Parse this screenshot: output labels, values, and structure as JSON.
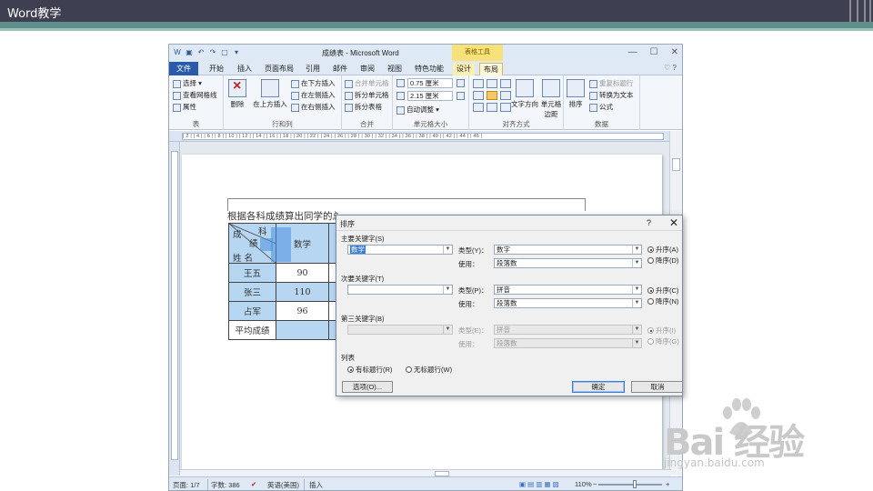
{
  "slide": {
    "title": "Word教学"
  },
  "window": {
    "title": "成绩表 - Microsoft Word",
    "context_tab_title": "表格工具",
    "controls": {
      "minimize": "—",
      "maximize": "☐",
      "close": "✕"
    },
    "qat": [
      "W",
      "▣",
      "↶",
      "↷",
      "▢",
      "▾"
    ]
  },
  "tabs": {
    "file": "文件",
    "items": [
      "开始",
      "插入",
      "页面布局",
      "引用",
      "邮件",
      "审阅",
      "视图",
      "特色功能",
      "设计",
      "布局"
    ],
    "right": "♡ ?"
  },
  "ribbon": {
    "table_group": {
      "label": "表",
      "items": [
        "选择 ▾",
        "查看网格线",
        "属性"
      ]
    },
    "rows_cols_group": {
      "label": "行和列",
      "delete": "删除",
      "insert_above": "在上方插入",
      "items": [
        "在下方插入",
        "在左侧插入",
        "在右侧插入"
      ]
    },
    "merge_group": {
      "label": "合并",
      "items": [
        "合并单元格",
        "拆分单元格",
        "拆分表格"
      ]
    },
    "cell_size_group": {
      "label": "单元格大小",
      "height": "0.75 厘米",
      "width": "2.15 厘米",
      "autofit": "自动调整 ▾"
    },
    "align_group": {
      "label": "对齐方式",
      "text_direction": "文字方向",
      "cell_margins": "单元格边距"
    },
    "data_group": {
      "label": "数据",
      "sort": "排序",
      "items": [
        "重复标题行",
        "转换为文本",
        "公式"
      ]
    }
  },
  "ruler": {
    "text": "| 2 | | 4 | | 6 | | 8 | | 10 | | 12 | | 14 | | 16 | | 18 | | 20 | | 22 | | 24 | | 26 | | 28 | | 30 | | 32 | | 34 | | 36 | | 38 | | 40 | | 42 | | 44 | | 46 |"
  },
  "document": {
    "sentence": "根据各科成绩算出同学的总",
    "header_cell": {
      "a": "成",
      "b": "绩",
      "c": "科",
      "d": "姓 名"
    },
    "col_header": "数学",
    "rows": [
      {
        "name": "王五",
        "score": "90"
      },
      {
        "name": "张三",
        "score": "110"
      },
      {
        "name": "占军",
        "score": "96"
      },
      {
        "name": "平均成绩",
        "score": ""
      }
    ]
  },
  "status": {
    "page": "页面: 1/7",
    "words": "字数: 386",
    "language": "英语(美国)",
    "mode": "插入",
    "zoom": "110%",
    "zoom_minus": "−",
    "zoom_plus": "+"
  },
  "dialog": {
    "title": "排序",
    "help": "?",
    "close": "✕",
    "primary": {
      "label": "主要关键字(S)",
      "value": "数学",
      "type_label": "类型(Y)：",
      "type_value": "数字",
      "using_label": "使用：",
      "using_value": "段落数",
      "asc": "升序(A)",
      "desc": "降序(D)"
    },
    "secondary": {
      "label": "次要关键字(T)",
      "value": "",
      "type_label": "类型(P)：",
      "type_value": "拼音",
      "using_label": "使用：",
      "using_value": "段落数",
      "asc": "升序(C)",
      "desc": "降序(N)"
    },
    "third": {
      "label": "第三关键字(B)",
      "value": "",
      "type_label": "类型(E)：",
      "type_value": "拼音",
      "using_label": "使用：",
      "using_value": "段落数",
      "asc": "升序(I)",
      "desc": "降序(G)"
    },
    "list": {
      "label": "列表",
      "header_row": "有标题行(R)",
      "no_header_row": "无标题行(W)"
    },
    "options": "选项(O)...",
    "ok": "确定",
    "cancel": "取消"
  },
  "watermark": {
    "logo": "Bai  经验",
    "url": "jingyan.baidu.com"
  }
}
